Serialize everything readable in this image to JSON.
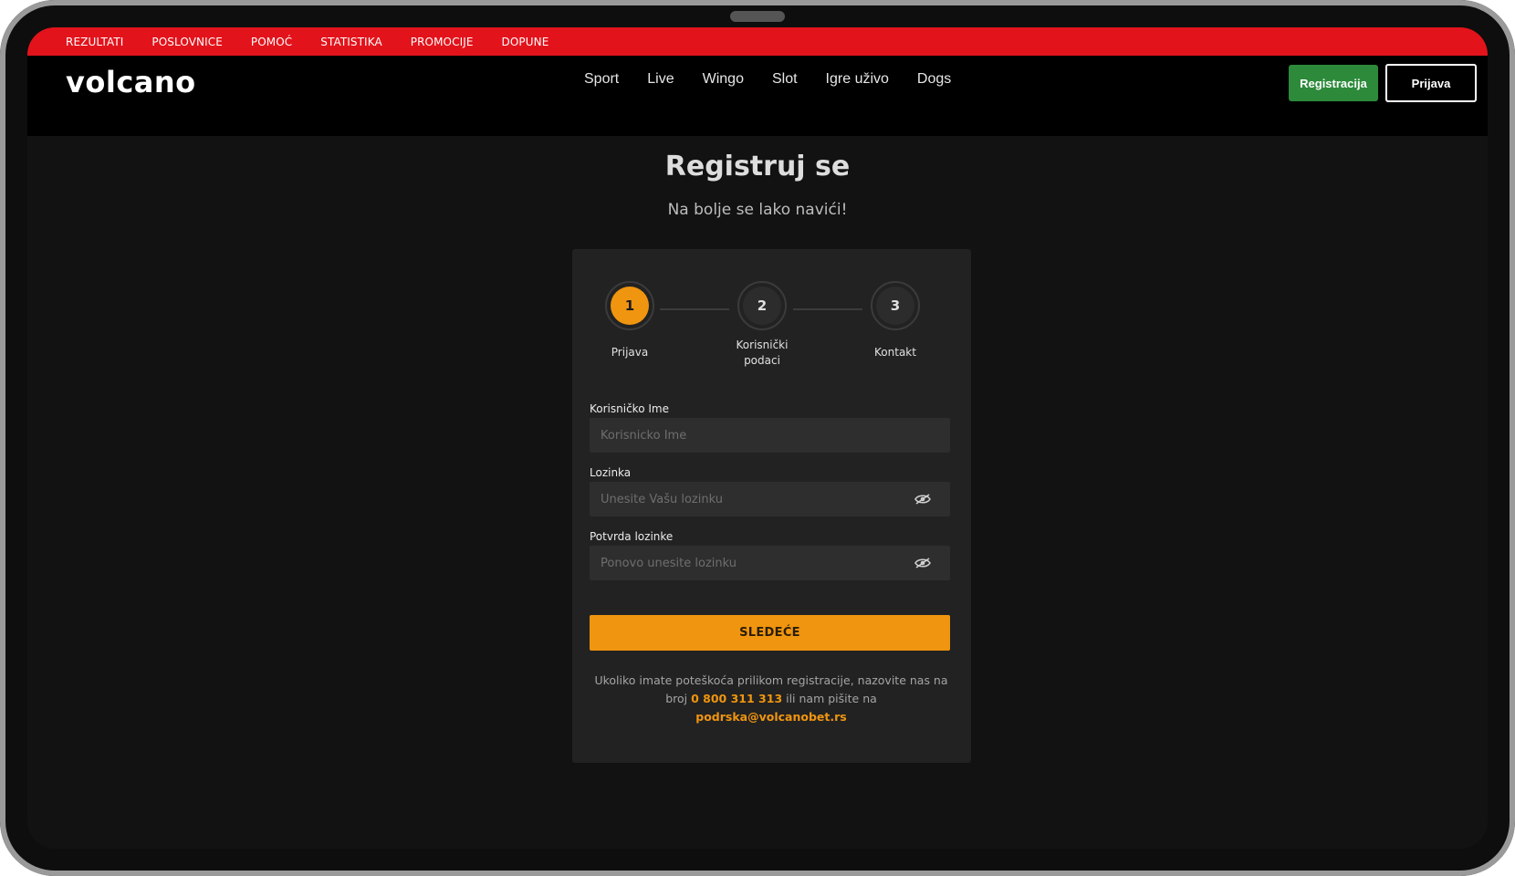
{
  "topbar": {
    "links": [
      "REZULTATI",
      "POSLOVNICE",
      "POMOĆ",
      "STATISTIKA",
      "PROMOCIJE",
      "DOPUNE"
    ]
  },
  "header": {
    "logo": "volcano",
    "nav": [
      "Sport",
      "Live",
      "Wingo",
      "Slot",
      "Igre uživo",
      "Dogs"
    ],
    "register_label": "Registracija",
    "login_label": "Prijava"
  },
  "page": {
    "title": "Registruj se",
    "subtitle": "Na bolje se lako navići!"
  },
  "steps": [
    {
      "number": "1",
      "label": "Prijava",
      "active": true
    },
    {
      "number": "2",
      "label": "Korisnički podaci",
      "active": false
    },
    {
      "number": "3",
      "label": "Kontakt",
      "active": false
    }
  ],
  "form": {
    "username_label": "Korisničko Ime",
    "username_placeholder": "Korisnicko Ime",
    "username_value": "",
    "password_label": "Lozinka",
    "password_placeholder": "Unesite Vašu lozinku",
    "password_value": "",
    "confirm_label": "Potvrda lozinke",
    "confirm_placeholder": "Ponovo unesite lozinku",
    "confirm_value": "",
    "next_label": "SLEDEĆE"
  },
  "help": {
    "text_before": "Ukoliko imate poteškoća prilikom registracije, nazovite nas na broj ",
    "phone": "0 800 311 313",
    "text_middle": " ili nam pišite na ",
    "email": "podrska@volcanobet.rs"
  },
  "colors": {
    "topbar_red": "#e3131b",
    "accent_orange": "#f0950f",
    "register_green": "#2c8a3a",
    "card_bg": "#222222",
    "page_bg": "#121212"
  },
  "icons": {
    "password_toggle": "eye-slash-icon"
  }
}
